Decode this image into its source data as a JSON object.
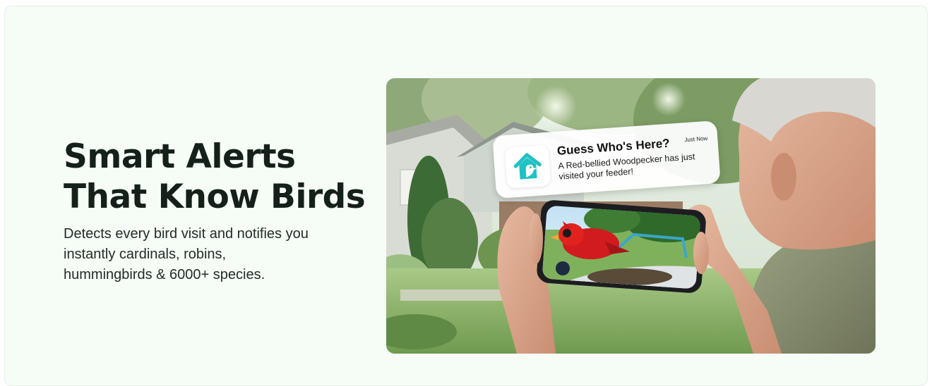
{
  "headline": {
    "line1": "Smart Alerts",
    "line2": "That Know Birds"
  },
  "description": "Detects every bird visit and notifies you instantly cardinals, robins, hummingbirds & 6000+ species.",
  "notification": {
    "title": "Guess Who's Here?",
    "time": "Just Now",
    "message": "A Red-bellied Woodpecker has just visited your feeder!",
    "icon": "birdhouse-icon"
  },
  "photo": {
    "subject": "hands-holding-phone-with-cardinal",
    "icon": "photo-illustration"
  },
  "colors": {
    "background": "#f5fdf6",
    "heading": "#14211a",
    "accent": "#1fc1c4"
  }
}
